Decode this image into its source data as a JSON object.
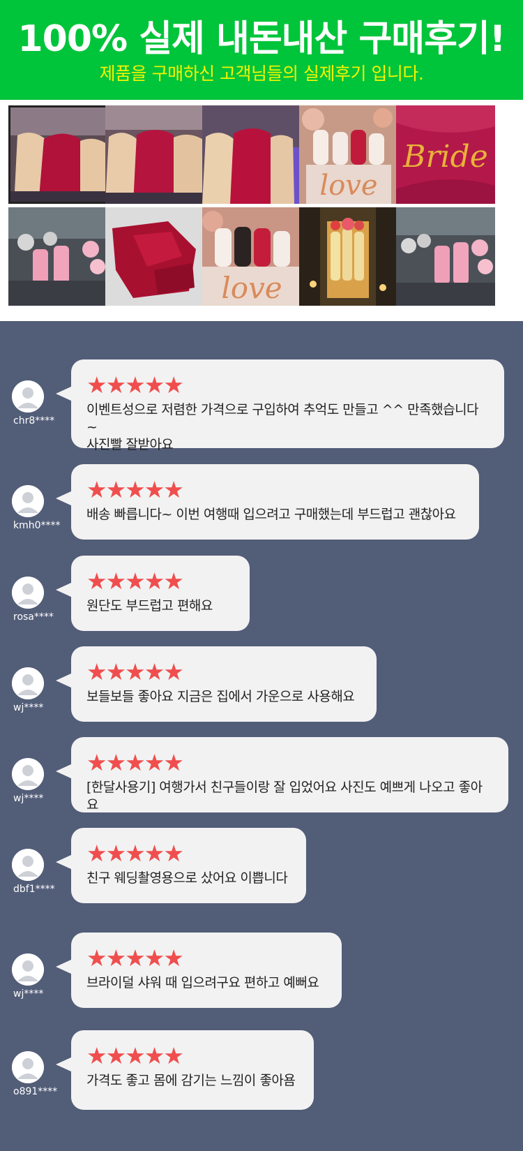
{
  "header": {
    "title": "100% 실제 내돈내산 구매후기!",
    "subtitle": "제품을 구매하신 고객님들의 실제후기 입니다."
  },
  "gallery": [
    {
      "caption": ""
    },
    {
      "caption": ""
    },
    {
      "caption": ""
    },
    {
      "caption": "love"
    },
    {
      "caption": "Bride"
    },
    {
      "caption": ""
    },
    {
      "caption": ""
    },
    {
      "caption": "love"
    },
    {
      "caption": ""
    },
    {
      "caption": ""
    }
  ],
  "reviews": [
    {
      "user": "chr8****",
      "stars": "★★★★★",
      "rating": 5,
      "text": "이벤트성으로 저렴한 가격으로 구입하여 추억도 만들고 ^^ 만족했습니다~\n사진빨 잘받아요"
    },
    {
      "user": "kmh0****",
      "stars": "★★★★★",
      "rating": 5,
      "text": "배송 빠릅니다~ 이번 여행때 입으려고 구매했는데 부드럽고 괜찮아요"
    },
    {
      "user": "rosa****",
      "stars": "★★★★★",
      "rating": 5,
      "text": "원단도 부드럽고 편해요"
    },
    {
      "user": "wj****",
      "stars": "★★★★★",
      "rating": 5,
      "text": "보들보들 좋아요 지금은 집에서 가운으로 사용해요"
    },
    {
      "user": "wj****",
      "stars": "★★★★★",
      "rating": 5,
      "text": "[한달사용기] 여행가서 친구들이랑 잘 입었어요 사진도 예쁘게 나오고 좋아요"
    },
    {
      "user": "dbf1****",
      "stars": "★★★★★",
      "rating": 5,
      "text": "친구 웨딩촬영용으로 샀어요 이쁩니다"
    },
    {
      "user": "wj****",
      "stars": "★★★★★",
      "rating": 5,
      "text": "브라이덜 샤워 때 입으려구요 편하고 예뻐요"
    },
    {
      "user": "o891****",
      "stars": "★★★★★",
      "rating": 5,
      "text": "가격도 좋고 몸에 감기는 느낌이 좋아욤"
    }
  ],
  "colors": {
    "header_bg": "#00c43a",
    "title": "#ffffff",
    "subtitle": "#f6f500",
    "page_bg": "#525d78",
    "bubble_bg": "#f2f2f2",
    "star": "#f04e4e"
  }
}
